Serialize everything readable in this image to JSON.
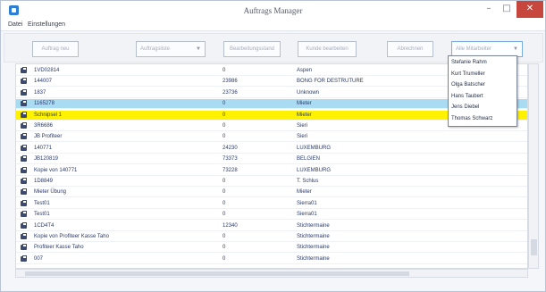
{
  "window": {
    "title": "Auftrags Manager",
    "controls": {
      "minimize": "–",
      "maximize": "□",
      "close": "✕"
    }
  },
  "menu": [
    "Datei",
    "Einstellungen"
  ],
  "toolbar": {
    "buttons": [
      "Auftrag neu",
      "Auftragsliste",
      "Bearbeitungsstand",
      "Kunde bearbeiten",
      "Abrechnen"
    ],
    "combo_selected": "Alle Mitarbeiter",
    "combo_placeholder": "Auftragsliste"
  },
  "dropdown_options": [
    "Stefanie Rahm",
    "Kurt Trumeller",
    "Olga Batscher",
    "Hans Taubert",
    "Jens Diebel",
    "Thomas Schwarz"
  ],
  "table": {
    "rows": [
      {
        "name": "1VD02814",
        "num": "0",
        "ort": "Aspen",
        "style": ""
      },
      {
        "name": "144007",
        "num": "23986",
        "ort": "BONG FOR DESTRUTURE",
        "style": ""
      },
      {
        "name": "1837",
        "num": "23736",
        "ort": "Unknown",
        "style": ""
      },
      {
        "name": "1165278",
        "num": "0",
        "ort": "Mieter",
        "style": "blue"
      },
      {
        "name": "Schnipsel 1",
        "num": "0",
        "ort": "Mieter",
        "style": "yellow"
      },
      {
        "name": "3R6686",
        "num": "0",
        "ort": "Sieri",
        "style": ""
      },
      {
        "name": "JB Profiteer",
        "num": "0",
        "ort": "Sieri",
        "style": ""
      },
      {
        "name": "140771",
        "num": "24230",
        "ort": "LUXEMBURG",
        "style": ""
      },
      {
        "name": "JB120819",
        "num": "73373",
        "ort": "BELGIEN",
        "style": ""
      },
      {
        "name": "Kopie von 140771",
        "num": "73228",
        "ort": "LUXEMBURG",
        "style": ""
      },
      {
        "name": "1D8849",
        "num": "0",
        "ort": "T. Schlus",
        "style": ""
      },
      {
        "name": "Mieter Übung",
        "num": "0",
        "ort": "Mieter",
        "style": ""
      },
      {
        "name": "Test01",
        "num": "0",
        "ort": "Sierra01",
        "style": ""
      },
      {
        "name": "Test01",
        "num": "0",
        "ort": "Sierra01",
        "style": ""
      },
      {
        "name": "1CD4T4",
        "num": "12340",
        "ort": "Stichtermaine",
        "style": ""
      },
      {
        "name": "Kopie von Profiteer Kasse Taho",
        "num": "0",
        "ort": "Stichtermaine",
        "style": ""
      },
      {
        "name": "Profiteer Kasse Taho",
        "num": "0",
        "ort": "Stichtermaine",
        "style": ""
      },
      {
        "name": "007",
        "num": "0",
        "ort": "Stichtermaine",
        "style": ""
      }
    ]
  }
}
